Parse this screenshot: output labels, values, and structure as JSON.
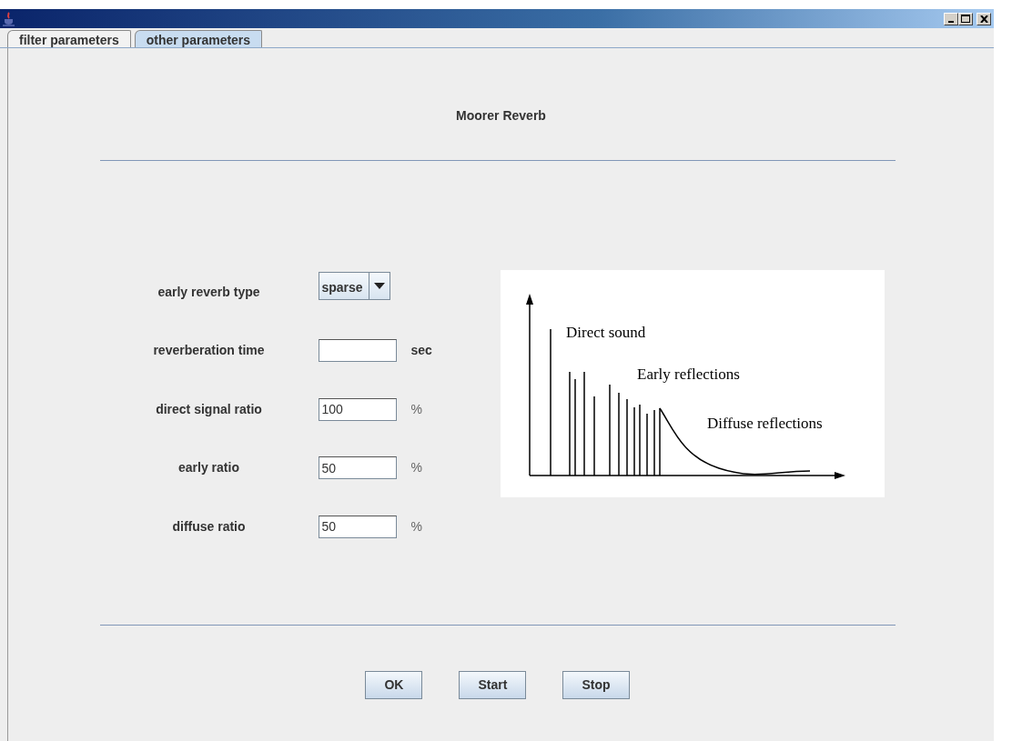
{
  "tabs": [
    {
      "label": "filter parameters",
      "selected": false
    },
    {
      "label": "other parameters",
      "selected": true
    }
  ],
  "panel": {
    "title": "Moorer Reverb",
    "fields": [
      {
        "kind": "dropdown",
        "label": "early reverb type",
        "value": "sparse"
      },
      {
        "kind": "text",
        "label": "reverberation time",
        "unit": "sec"
      },
      {
        "kind": "text",
        "label": "direct signal ratio",
        "value": "100",
        "unit": "%"
      },
      {
        "kind": "text",
        "label": "early ratio",
        "value": "50",
        "unit": "%"
      },
      {
        "kind": "text",
        "label": "diffuse ratio",
        "value": "50",
        "unit": "%"
      }
    ],
    "diagram": {
      "labels": [
        "Direct sound",
        "Early reflections",
        "Diffuse reflections"
      ]
    },
    "buttons": [
      "OK",
      "Start",
      "Stop"
    ]
  }
}
